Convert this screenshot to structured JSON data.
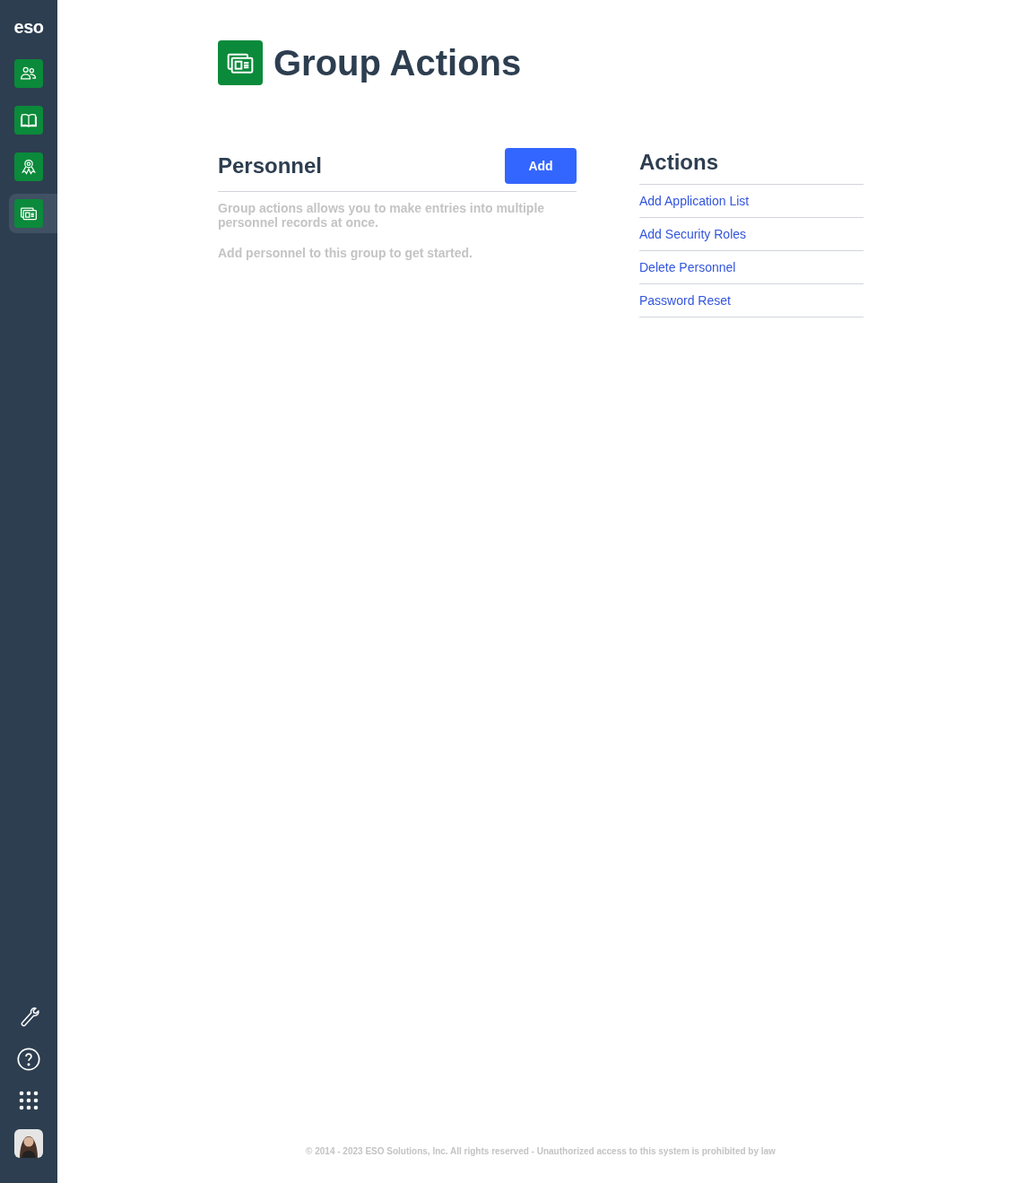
{
  "sidebar": {
    "logo": "eso",
    "nav_items": [
      {
        "kind": "people",
        "selected": false
      },
      {
        "kind": "book",
        "selected": false
      },
      {
        "kind": "award",
        "selected": false
      },
      {
        "kind": "group",
        "selected": true
      }
    ],
    "bottom_items": [
      {
        "kind": "wrench"
      },
      {
        "kind": "help"
      },
      {
        "kind": "apps"
      },
      {
        "kind": "avatar"
      }
    ]
  },
  "page": {
    "title": "Group Actions"
  },
  "personnel": {
    "heading": "Personnel",
    "add_button": "Add",
    "description": "Group actions allows you to make entries into multiple personnel records at once.",
    "hint": "Add personnel to this group to get started."
  },
  "actions": {
    "heading": "Actions",
    "links": [
      "Add Application List",
      "Add Security Roles",
      "Delete Personnel",
      "Password Reset"
    ]
  },
  "footer": "© 2014 - 2023 ESO Solutions, Inc. All rights reserved - Unauthorized access to this system is prohibited by law"
}
